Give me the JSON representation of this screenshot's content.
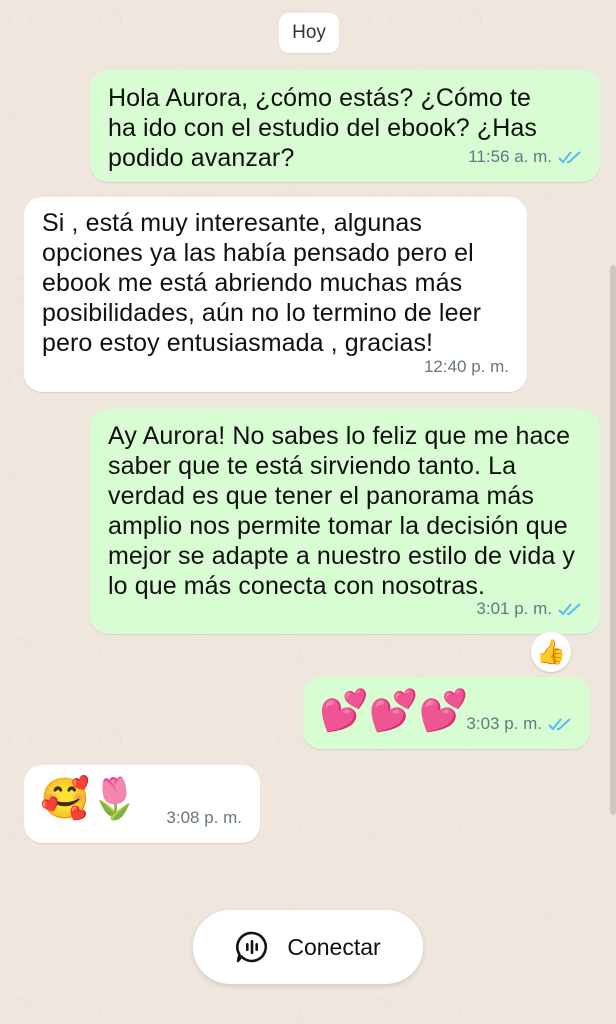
{
  "date_chip": "Hoy",
  "messages": [
    {
      "direction": "outgoing",
      "text": "Hola Aurora, ¿cómo estás? ¿Cómo te\nha ido con el estudio del ebook? ¿Has\npodido avanzar?",
      "time": "11:56 a. m.",
      "status": "read"
    },
    {
      "direction": "incoming",
      "text": "Si , está muy interesante, algunas\nopciones ya las había pensado pero el\nebook me está abriendo muchas más\nposibilidades, aún no lo termino de leer\npero estoy entusiasmada , gracias!",
      "time": "12:40 p. m."
    },
    {
      "direction": "outgoing",
      "text": "Ay Aurora! No sabes lo feliz que me hace\nsaber que te está sirviendo tanto. La\nverdad es que tener el panorama más\namplio nos permite tomar la decisión que\nmejor se adapte a nuestro estilo de vida y\nlo que más conecta con nosotras.",
      "time": "3:01 p. m.",
      "status": "read",
      "reaction": "👍"
    },
    {
      "direction": "outgoing",
      "text": "💕💕💕",
      "time": "3:03 p. m.",
      "status": "read"
    },
    {
      "direction": "incoming",
      "text": "🥰🌷",
      "time": "3:08 p. m."
    }
  ],
  "connect_button": {
    "label": "Conectar",
    "icon": "voice-chat-icon"
  },
  "colors": {
    "outgoing_bubble": "#d9fdd3",
    "incoming_bubble": "#ffffff",
    "read_ticks": "#53bdeb",
    "background": "#efe7de"
  }
}
